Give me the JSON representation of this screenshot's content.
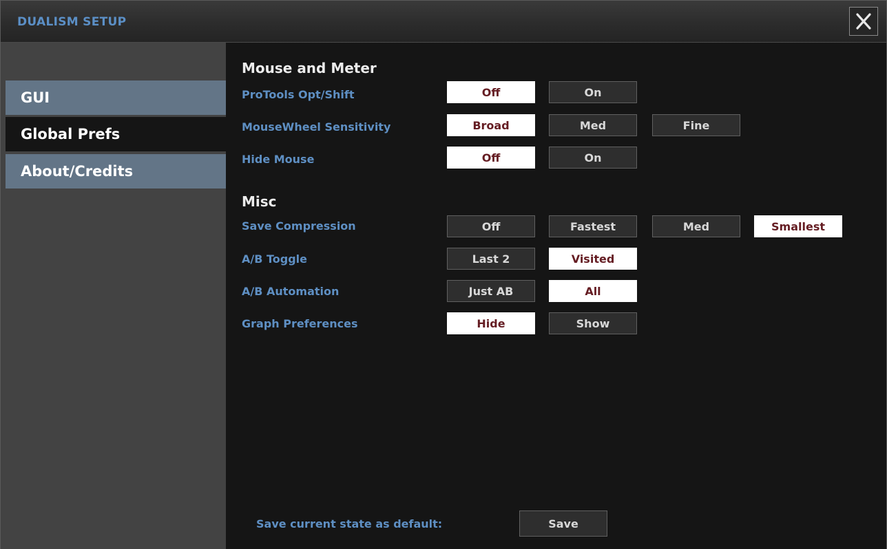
{
  "window": {
    "title": "DUALISM SETUP",
    "close_icon": "close-icon"
  },
  "sidebar": {
    "items": [
      {
        "label": "GUI",
        "active": false
      },
      {
        "label": "Global Prefs",
        "active": true
      },
      {
        "label": "About/Credits",
        "active": false
      }
    ]
  },
  "sections": [
    {
      "heading": "Mouse and Meter",
      "rows": [
        {
          "label": "ProTools Opt/Shift",
          "options": [
            "Off",
            "On"
          ],
          "selected": 0
        },
        {
          "label": "MouseWheel Sensitivity",
          "options": [
            "Broad",
            "Med",
            "Fine"
          ],
          "selected": 0
        },
        {
          "label": "Hide Mouse",
          "options": [
            "Off",
            "On"
          ],
          "selected": 0
        }
      ]
    },
    {
      "heading": "Misc",
      "rows": [
        {
          "label": "Save Compression",
          "options": [
            "Off",
            "Fastest",
            "Med",
            "Smallest"
          ],
          "selected": 3
        },
        {
          "label": "A/B Toggle",
          "options": [
            "Last 2",
            "Visited"
          ],
          "selected": 1
        },
        {
          "label": "A/B Automation",
          "options": [
            "Just AB",
            "All"
          ],
          "selected": 1
        },
        {
          "label": "Graph Preferences",
          "options": [
            "Hide",
            "Show"
          ],
          "selected": 0
        }
      ]
    }
  ],
  "footer": {
    "save_label": "Save current state as default:",
    "save_button": "Save"
  },
  "colors": {
    "label_blue": "#5e8fc3",
    "sidebar_tab": "#637587",
    "selected_bg": "#ffffff",
    "selected_text": "#651d23",
    "unselected_bg": "#2e2e2e"
  }
}
